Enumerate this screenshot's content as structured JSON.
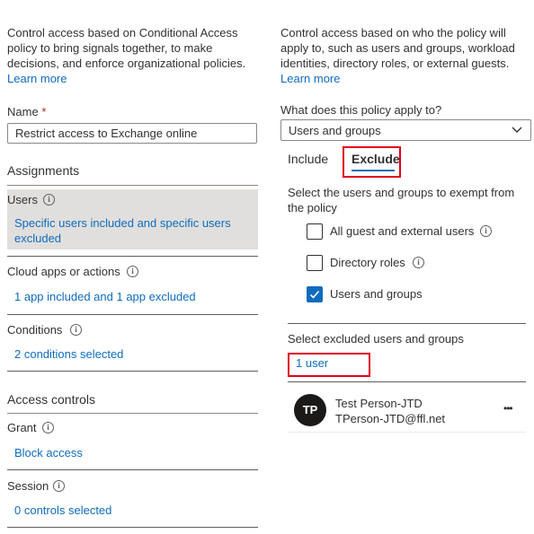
{
  "left": {
    "description": "Control access based on Conditional Access policy to bring signals together, to make decisions, and enforce organizational policies.",
    "learn_more": "Learn more",
    "name_label": "Name",
    "name_required": "*",
    "name_value": "Restrict access to Exchange online",
    "assignments_heading": "Assignments",
    "users_label": "Users",
    "users_summary": "Specific users included and specific users excluded",
    "cloud_apps_label": "Cloud apps or actions",
    "cloud_apps_summary": "1 app included and 1 app excluded",
    "conditions_label": "Conditions",
    "conditions_summary": "2 conditions selected",
    "access_controls_heading": "Access controls",
    "grant_label": "Grant",
    "grant_summary": "Block access",
    "session_label": "Session",
    "session_summary": "0 controls selected"
  },
  "right": {
    "description": "Control access based on who the policy will apply to, such as users and groups, workload identities, directory roles, or external guests.",
    "learn_more": "Learn more",
    "applies_to_label": "What does this policy apply to?",
    "applies_to_value": "Users and groups",
    "tabs": [
      {
        "label": "Include",
        "selected": false
      },
      {
        "label": "Exclude",
        "selected": true
      }
    ],
    "exclude_instruction": "Select the users and groups to exempt from the policy",
    "options": [
      {
        "label": "All guest and external users",
        "checked": false,
        "info": true
      },
      {
        "label": "Directory roles",
        "checked": false,
        "info": true
      },
      {
        "label": "Users and groups",
        "checked": true,
        "info": false
      }
    ],
    "select_excluded_label": "Select excluded users and groups",
    "selected_count_link": "1 user",
    "user": {
      "initials": "TP",
      "name": "Test Person-JTD",
      "email": "TPerson-JTD@ffl.net",
      "more": "•••"
    }
  },
  "colors": {
    "link": "#0f6cbd",
    "highlight_box": "#e0001b",
    "selected_row_bg": "#e1dfdd",
    "checkbox_checked": "#0f6cbd"
  }
}
